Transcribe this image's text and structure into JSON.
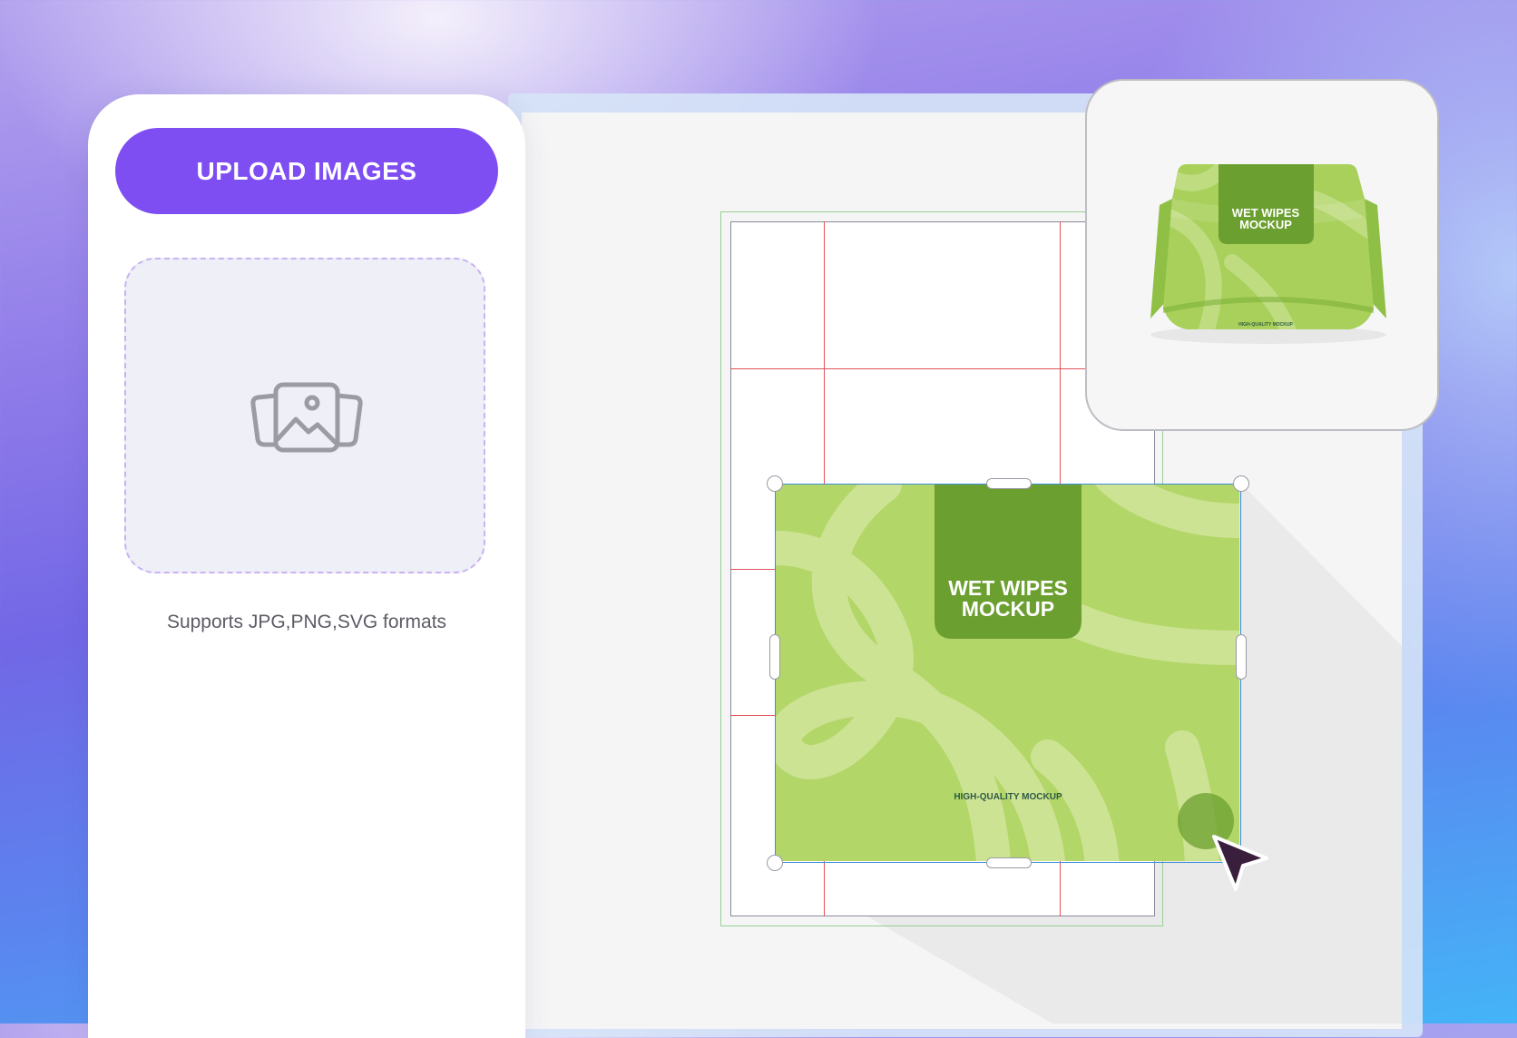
{
  "left_panel": {
    "upload_button_label": "UPLOAD IMAGES",
    "dropzone_icon": "images-icon",
    "formats_note": "Supports JPG,PNG,SVG formats"
  },
  "artwork": {
    "label_line1": "WET WIPES",
    "label_line2": "MOCKUP",
    "tagline": "HIGH-QUALITY MOCKUP"
  },
  "preview": {
    "label_line1": "WET WIPES",
    "label_line2": "MOCKUP",
    "tagline": "HIGH-QUALITY MOCKUP"
  },
  "colors": {
    "accent": "#7f4ef3",
    "artwork_green": "#b3d668",
    "label_green": "#6b9f2f",
    "guide_red": "#e0525a",
    "selection_blue": "#3b8fd8",
    "cursor": "#3a1f3d"
  },
  "icons": [
    "images-icon",
    "pointer-cursor-icon"
  ]
}
